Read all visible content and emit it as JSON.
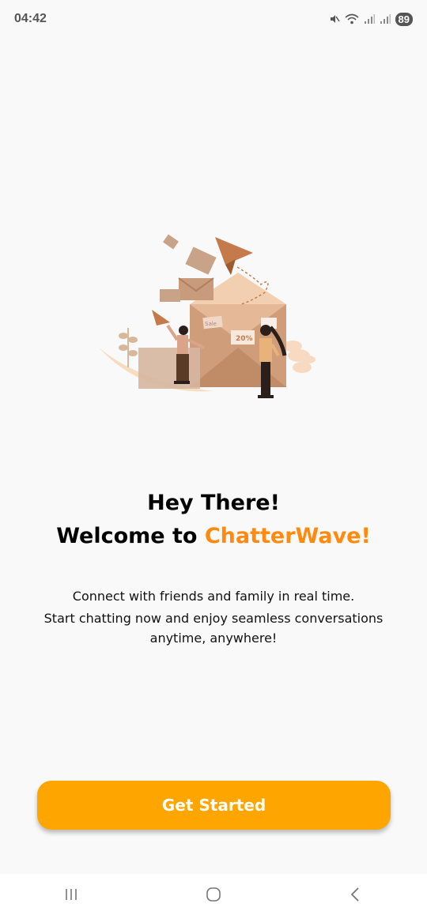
{
  "status_bar": {
    "time": "04:42",
    "battery": "89",
    "icons": [
      "mute-icon",
      "wifi-icon",
      "signal-icon",
      "signal-icon",
      "battery-icon"
    ]
  },
  "illustration": {
    "icon": "mail-people-illustration",
    "tags": [
      "Sale",
      "20%"
    ]
  },
  "welcome": {
    "line1": "Hey There!",
    "line2_prefix": "Welcome to ",
    "brand": "ChatterWave!"
  },
  "description": {
    "line1": "Connect with friends and family in real time.",
    "line2": "Start chatting now and enjoy seamless conversations",
    "line3": "anytime, anywhere!"
  },
  "cta": {
    "label": "Get Started"
  },
  "colors": {
    "accent": "#ffa500",
    "brand_text": "#ff8a0d",
    "background": "#f9f9f9"
  },
  "nav_bar": {
    "icons": [
      "recent-apps-icon",
      "home-icon",
      "back-icon"
    ]
  }
}
